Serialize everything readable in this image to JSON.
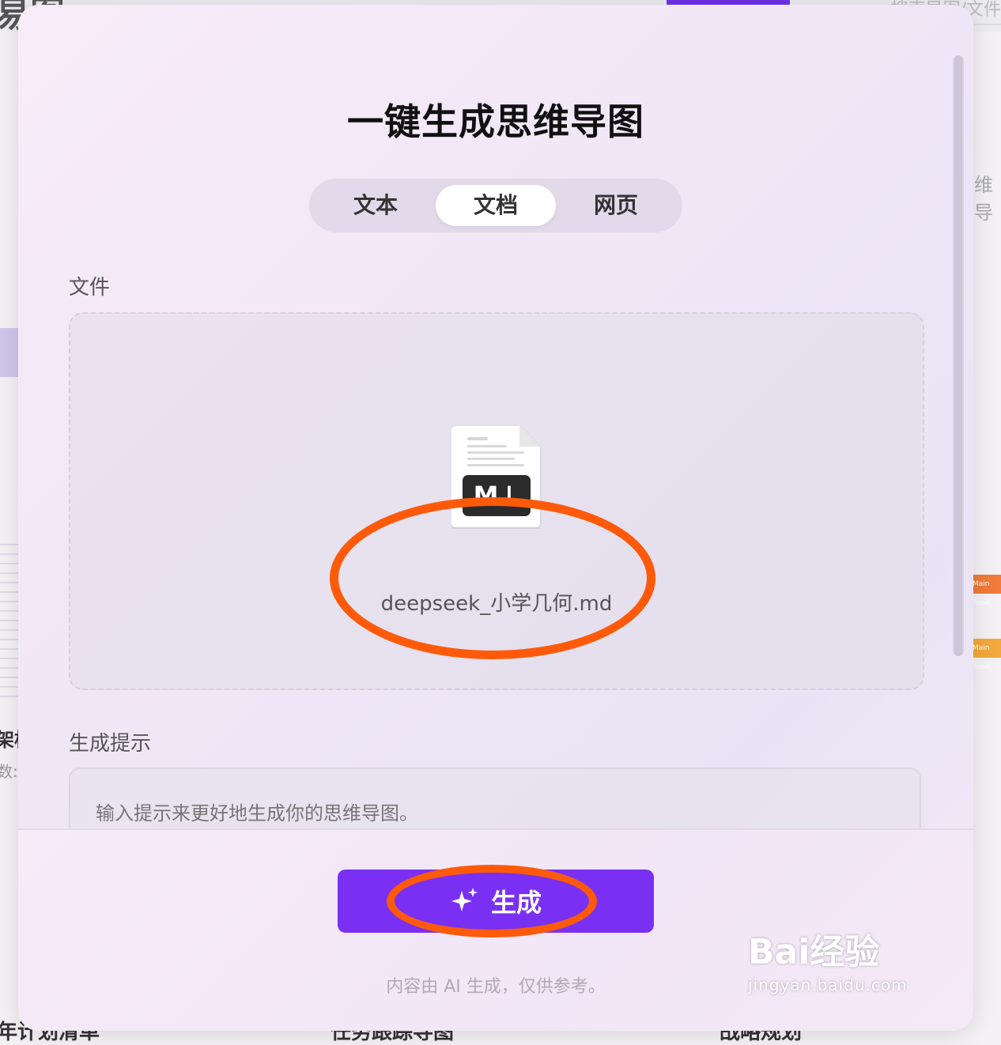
{
  "background": {
    "search_text": "搜索导图/文件",
    "right_text": "维导",
    "left_text_1": "架构",
    "left_text_2": "数:",
    "bottom_text_1": "年计划清单",
    "bottom_text_2": "任务跟踪导图",
    "bottom_text_3": "战略规划",
    "topic_tag": "Main Topic"
  },
  "modal": {
    "title": "一键生成思维导图",
    "tabs": [
      {
        "label": "文本",
        "active": false
      },
      {
        "label": "文档",
        "active": true
      },
      {
        "label": "网页",
        "active": false
      }
    ],
    "file_section_label": "文件",
    "uploaded_file": {
      "name": "deepseek_小学几何.md",
      "icon": "markdown-file-icon",
      "badge": "M↓"
    },
    "prompt_section_label": "生成提示",
    "prompt_placeholder": "输入提示来更好地生成你的思维导图。",
    "generate_button": {
      "label": "生成",
      "icon": "sparkle-icon"
    },
    "disclaimer": "内容由 AI 生成，仅供参考。"
  },
  "watermark": {
    "main": "Bai经验",
    "sub": "jingyan.baidu.com"
  },
  "colors": {
    "accent": "#7a30f2",
    "annotation": "#ff5a0a",
    "title": "#111111"
  }
}
